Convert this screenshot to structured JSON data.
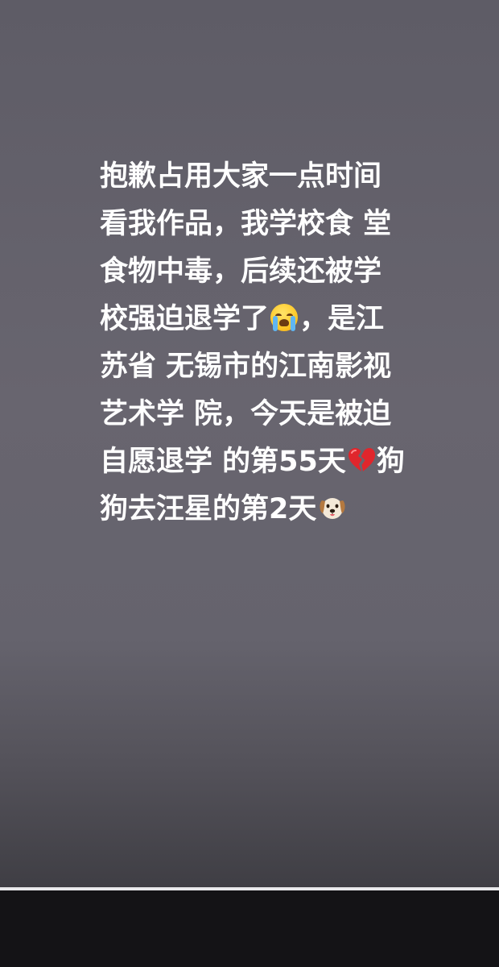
{
  "story": {
    "lines": [
      "抱歉占用大家一点时间",
      "看我作品，我学校食 堂",
      "食物中毒，后续还被学",
      "校强迫退学了",
      "，是江",
      "苏省 无锡市的江南影视",
      "艺术学 院，今天是被迫",
      "自愿退学 的第55天",
      "狗",
      "狗去汪星的第2天"
    ],
    "emojis": [
      "crying-face",
      "broken-heart",
      "dog-face"
    ]
  },
  "playback": {
    "progress": 1.0
  }
}
